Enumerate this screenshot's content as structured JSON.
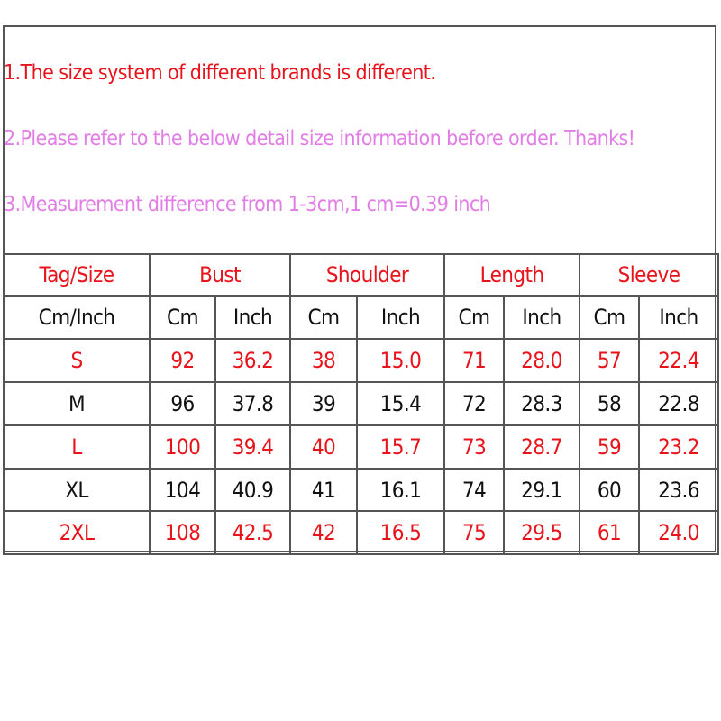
{
  "notes": [
    "1.The size system of different brands is different.",
    "2.Please refer to the below detail size information before order. Thanks!",
    "3.Measurement difference from 1-3cm,1 cm=0.39 inch"
  ],
  "colors": {
    "red": "#e8141c",
    "pink": "#e27de6",
    "black": "#111111"
  },
  "table": {
    "headers": [
      "Tag/Size",
      "Bust",
      "Shoulder",
      "Length",
      "Sleeve"
    ],
    "subheaders": [
      "Cm/Inch",
      "Cm",
      "Inch",
      "Cm",
      "Inch",
      "Cm",
      "Inch",
      "Cm",
      "Inch"
    ],
    "rows": [
      [
        "S",
        "92",
        "36.2",
        "38",
        "15.0",
        "71",
        "28.0",
        "57",
        "22.4"
      ],
      [
        "M",
        "96",
        "37.8",
        "39",
        "15.4",
        "72",
        "28.3",
        "58",
        "22.8"
      ],
      [
        "L",
        "100",
        "39.4",
        "40",
        "15.7",
        "73",
        "28.7",
        "59",
        "23.2"
      ],
      [
        "XL",
        "104",
        "40.9",
        "41",
        "16.1",
        "74",
        "29.1",
        "60",
        "23.6"
      ],
      [
        "2XL",
        "108",
        "42.5",
        "42",
        "16.5",
        "75",
        "29.5",
        "61",
        "24.0"
      ]
    ]
  }
}
